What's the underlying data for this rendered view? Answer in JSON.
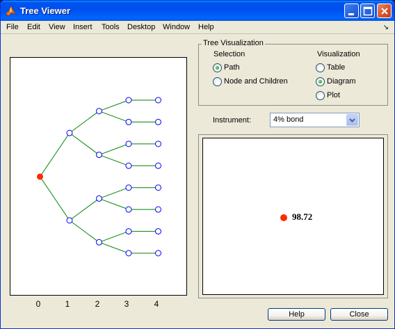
{
  "window": {
    "title": "Tree Viewer",
    "accent": "#0054e3"
  },
  "menubar": {
    "items": [
      "File",
      "Edit",
      "View",
      "Insert",
      "Tools",
      "Desktop",
      "Window",
      "Help"
    ],
    "dock_icon": "dock-arrow-icon"
  },
  "tree_visualization": {
    "title": "Tree Visualization",
    "selection": {
      "heading": "Selection",
      "options": [
        {
          "label": "Path",
          "selected": true
        },
        {
          "label": "Node and Children",
          "selected": false
        }
      ]
    },
    "visualization": {
      "heading": "Visualization",
      "options": [
        {
          "label": "Table",
          "selected": false
        },
        {
          "label": "Diagram",
          "selected": true
        },
        {
          "label": "Plot",
          "selected": false
        }
      ]
    }
  },
  "instrument": {
    "label": "Instrument:",
    "selected": "4% bond"
  },
  "diagram": {
    "value": "98.72",
    "dot_color": "#ff2a00"
  },
  "buttons": {
    "help": "Help",
    "close": "Close"
  },
  "chart_data": {
    "type": "scatter",
    "title": "",
    "xlabel": "",
    "ylabel": "",
    "x_ticks": [
      "0",
      "1",
      "2",
      "3",
      "4"
    ],
    "xlim": [
      -1,
      5
    ],
    "grid": false,
    "node_color": "#0000ff",
    "edge_color": "#008000",
    "selected_color": "#ff2a00",
    "nodes_per_level": [
      1,
      2,
      4,
      8,
      8
    ]
  }
}
